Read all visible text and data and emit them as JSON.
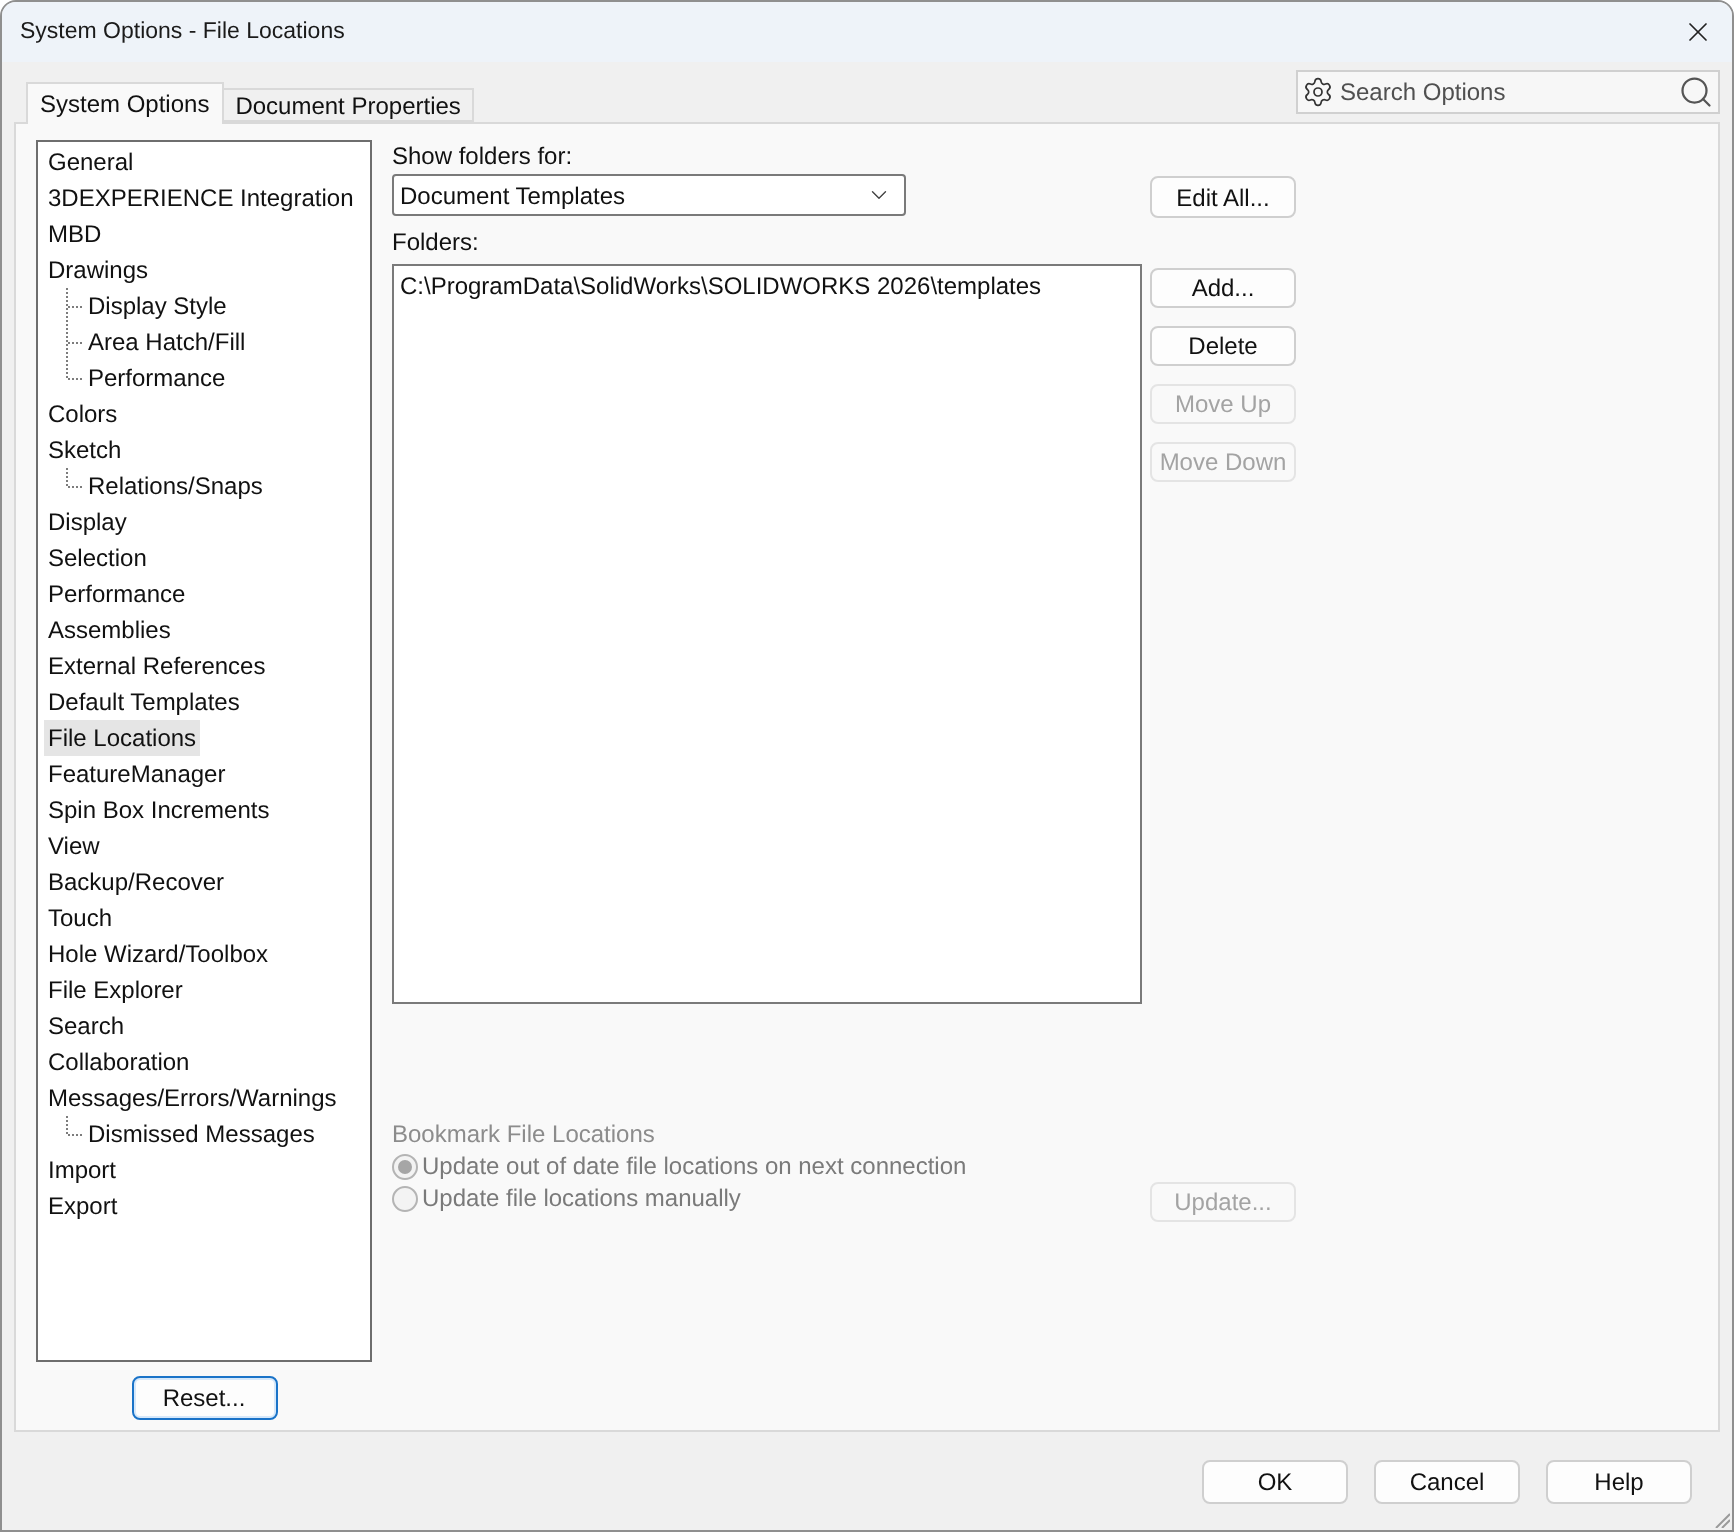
{
  "window": {
    "title": "System Options - File Locations"
  },
  "tabs": [
    {
      "label": "System Options",
      "selected": true
    },
    {
      "label": "Document Properties",
      "selected": false
    }
  ],
  "search": {
    "placeholder": "Search Options"
  },
  "tree": [
    {
      "label": "General",
      "selected": false
    },
    {
      "label": "3DEXPERIENCE Integration",
      "selected": false
    },
    {
      "label": "MBD",
      "selected": false
    },
    {
      "label": "Drawings",
      "selected": false,
      "children": [
        {
          "label": "Display Style",
          "selected": false
        },
        {
          "label": "Area Hatch/Fill",
          "selected": false
        },
        {
          "label": "Performance",
          "selected": false
        }
      ]
    },
    {
      "label": "Colors",
      "selected": false
    },
    {
      "label": "Sketch",
      "selected": false,
      "children": [
        {
          "label": "Relations/Snaps",
          "selected": false
        }
      ]
    },
    {
      "label": "Display",
      "selected": false
    },
    {
      "label": "Selection",
      "selected": false
    },
    {
      "label": "Performance",
      "selected": false
    },
    {
      "label": "Assemblies",
      "selected": false
    },
    {
      "label": "External References",
      "selected": false
    },
    {
      "label": "Default Templates",
      "selected": false
    },
    {
      "label": "File Locations",
      "selected": true
    },
    {
      "label": "FeatureManager",
      "selected": false
    },
    {
      "label": "Spin Box Increments",
      "selected": false
    },
    {
      "label": "View",
      "selected": false
    },
    {
      "label": "Backup/Recover",
      "selected": false
    },
    {
      "label": "Touch",
      "selected": false
    },
    {
      "label": "Hole Wizard/Toolbox",
      "selected": false
    },
    {
      "label": "File Explorer",
      "selected": false
    },
    {
      "label": "Search",
      "selected": false
    },
    {
      "label": "Collaboration",
      "selected": false
    },
    {
      "label": "Messages/Errors/Warnings",
      "selected": false,
      "children": [
        {
          "label": "Dismissed Messages",
          "selected": false
        }
      ]
    },
    {
      "label": "Import",
      "selected": false
    },
    {
      "label": "Export",
      "selected": false
    }
  ],
  "reset_button": {
    "label": "Reset...",
    "focused": true
  },
  "show_folders_for": {
    "label": "Show folders for:",
    "value": "Document Templates",
    "button": {
      "label": "Edit All...",
      "disabled": false
    }
  },
  "folders": {
    "label": "Folders:",
    "items": [
      "C:\\ProgramData\\SolidWorks\\SOLIDWORKS 2026\\templates"
    ],
    "buttons": [
      {
        "label": "Add...",
        "disabled": false
      },
      {
        "label": "Delete",
        "disabled": false
      },
      {
        "label": "Move Up",
        "disabled": true
      },
      {
        "label": "Move Down",
        "disabled": true
      }
    ]
  },
  "bookmark": {
    "title": "Bookmark File Locations",
    "disabled": true,
    "options": [
      {
        "label": "Update out of date file locations on next connection",
        "selected": true
      },
      {
        "label": "Update file locations manually",
        "selected": false
      }
    ],
    "button": {
      "label": "Update...",
      "disabled": true
    }
  },
  "footer_buttons": [
    {
      "label": "OK"
    },
    {
      "label": "Cancel"
    },
    {
      "label": "Help"
    }
  ]
}
